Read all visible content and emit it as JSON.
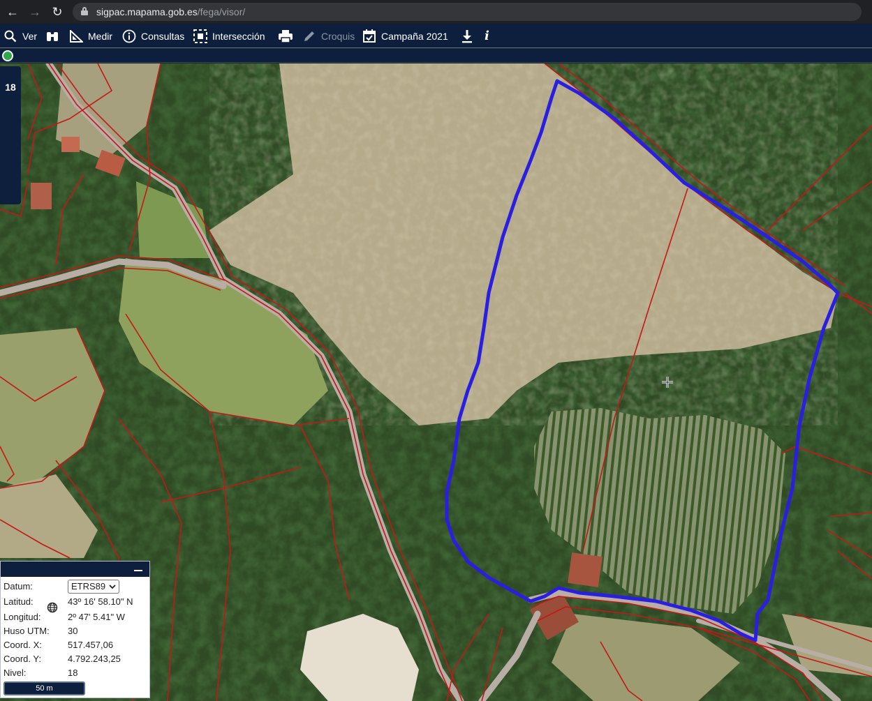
{
  "browser": {
    "url_host": "sigpac.mapama.gob.es",
    "url_path": "/fega/visor/"
  },
  "toolbar": {
    "items": [
      {
        "label": "Ver",
        "icon": "search-icon"
      },
      {
        "label": "",
        "icon": "binoculars-icon"
      },
      {
        "label": "Medir",
        "icon": "ruler-icon"
      },
      {
        "label": "Consultas",
        "icon": "info-icon"
      },
      {
        "label": "Intersección",
        "icon": "selection-icon"
      },
      {
        "label": "",
        "icon": "printer-icon"
      },
      {
        "label": "Croquis",
        "icon": "pencil-icon",
        "disabled": true
      },
      {
        "label": "Campaña 2021",
        "icon": "calendar-check-icon"
      },
      {
        "label": "",
        "icon": "download-icon"
      },
      {
        "label": "i",
        "icon": "info-italic-icon"
      }
    ]
  },
  "map": {
    "zoom_level": "18",
    "parcel_outline_color": "#2a1fe0",
    "boundary_color": "#c41818",
    "road_color": "#b9aea5"
  },
  "coords": {
    "datum_label": "Datum:",
    "datum_value": "ETRS89",
    "lat_label": "Latitud:",
    "lat_value": "43º 16' 58.10\" N",
    "lon_label": "Longitud:",
    "lon_value": "2º 47' 5.41\" W",
    "huso_label": "Huso UTM:",
    "huso_value": "30",
    "x_label": "Coord. X:",
    "x_value": "517.457,06",
    "y_label": "Coord. Y:",
    "y_value": "4.792.243,25",
    "nivel_label": "Nivel:",
    "nivel_value": "18",
    "scale_label": "50 m"
  }
}
